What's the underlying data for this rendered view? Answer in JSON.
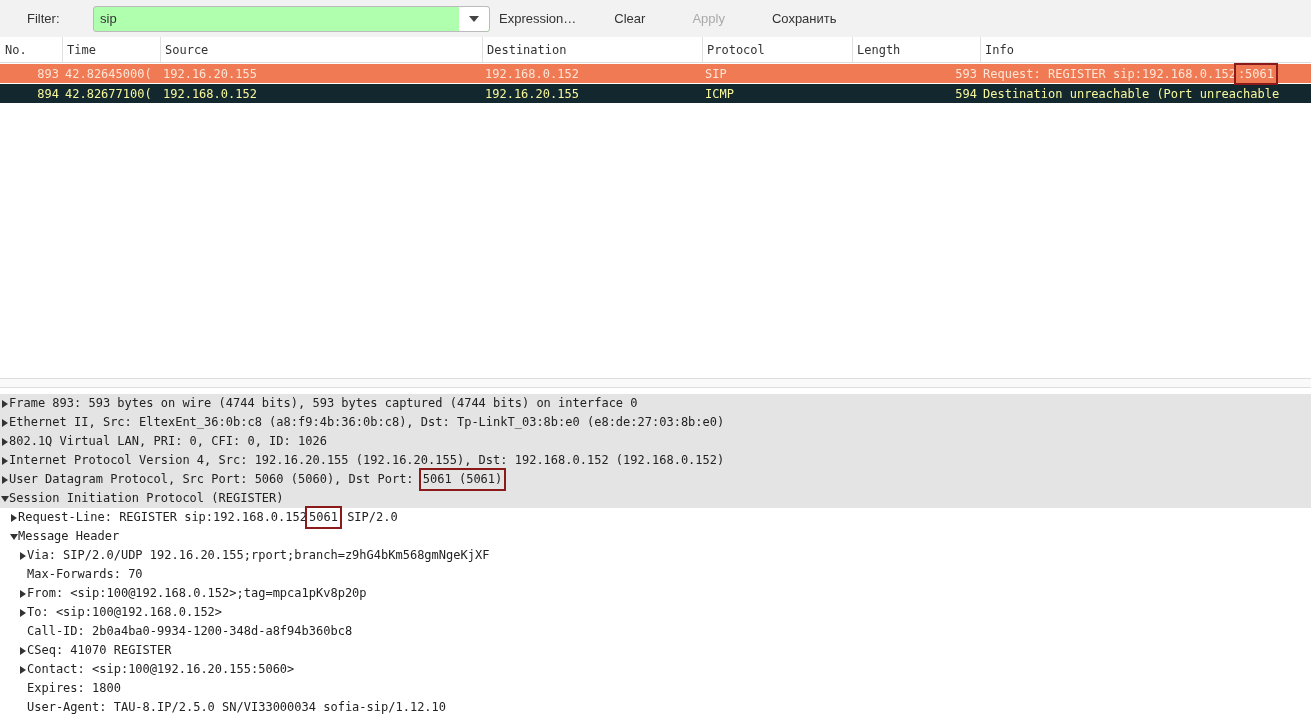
{
  "filter_bar": {
    "label": "Filter:",
    "field": {
      "value": "sip",
      "valid": true
    },
    "buttons": [
      {
        "label": "Expression…",
        "disabled": false
      },
      {
        "label": "Clear",
        "disabled": false
      },
      {
        "label": "Apply",
        "disabled": true
      },
      {
        "label": "Сохранить",
        "disabled": false
      }
    ]
  },
  "packet_list": {
    "columns": [
      "No.",
      "Time",
      "Source",
      "Destination",
      "Protocol",
      "Length",
      "Info"
    ],
    "rows": [
      {
        "cells": [
          "893",
          "42.82645000(",
          "192.16.20.155",
          "192.168.0.152",
          "SIP",
          "593"
        ],
        "info": [
          {
            "text": "Request: REGISTER sip:192.168.0.152"
          },
          {
            "text": ":5061",
            "highlight": true
          }
        ],
        "color": "#ef7a53",
        "selected": false
      },
      {
        "cells": [
          "894",
          "42.82677100(",
          "192.168.0.152",
          "192.16.20.155",
          "ICMP",
          "594"
        ],
        "info": [
          {
            "text": "Destination unreachable (Port unreachable"
          }
        ],
        "color": "#12272e",
        "selected": false
      }
    ]
  },
  "details": [
    {
      "kind": "node",
      "expanded": false,
      "parts": [
        {
          "text": "Frame 893: 593 bytes on wire (4744 bits), 593 bytes captured (4744 bits) on interface 0"
        }
      ]
    },
    {
      "kind": "node",
      "expanded": false,
      "parts": [
        {
          "text": "Ethernet II, Src: EltexEnt_36:0b:c8 (a8:f9:4b:36:0b:c8), Dst: Tp-LinkT_03:8b:e0 (e8:de:27:03:8b:e0)"
        }
      ]
    },
    {
      "kind": "node",
      "expanded": false,
      "parts": [
        {
          "text": "802.1Q Virtual LAN, PRI: 0, CFI: 0, ID: 1026"
        }
      ]
    },
    {
      "kind": "node",
      "expanded": false,
      "parts": [
        {
          "text": "Internet Protocol Version 4, Src: 192.16.20.155 (192.16.20.155), Dst: 192.168.0.152 (192.168.0.152)"
        }
      ]
    },
    {
      "kind": "node",
      "expanded": false,
      "parts": [
        {
          "text": "User Datagram Protocol, Src Port: 5060 (5060), Dst Port: "
        },
        {
          "text": "5061 (5061)",
          "highlight": true
        }
      ]
    },
    {
      "kind": "node",
      "expanded": true,
      "parts": [
        {
          "text": "Session Initiation Protocol (REGISTER)"
        }
      ],
      "children": [
        {
          "kind": "node",
          "expanded": false,
          "parts": [
            {
              "text": "Request-Line: REGISTER sip:192.168.0.152"
            },
            {
              "text": "5061",
              "highlight": true
            },
            {
              "text": "SIP/2.0"
            }
          ]
        },
        {
          "kind": "node",
          "expanded": true,
          "parts": [
            {
              "text": "Message Header"
            }
          ],
          "children": [
            {
              "kind": "node",
              "expanded": false,
              "parts": [
                {
                  "text": "Via: SIP/2.0/UDP 192.16.20.155;rport;branch=z9hG4bKm568gmNgeKjXF"
                }
              ]
            },
            {
              "kind": "leaf",
              "parts": [
                {
                  "text": "Max-Forwards: 70"
                }
              ]
            },
            {
              "kind": "node",
              "expanded": false,
              "parts": [
                {
                  "text": "From: <sip:100@192.168.0.152>;tag=mpca1pKv8p20p"
                }
              ]
            },
            {
              "kind": "node",
              "expanded": false,
              "parts": [
                {
                  "text": "To: <sip:100@192.168.0.152>"
                }
              ]
            },
            {
              "kind": "leaf",
              "parts": [
                {
                  "text": "Call-ID: 2b0a4ba0-9934-1200-348d-a8f94b360bc8"
                }
              ]
            },
            {
              "kind": "node",
              "expanded": false,
              "parts": [
                {
                  "text": "CSeq: 41070 REGISTER"
                }
              ]
            },
            {
              "kind": "node",
              "expanded": false,
              "parts": [
                {
                  "text": "Contact: <sip:100@192.16.20.155:5060>"
                }
              ]
            },
            {
              "kind": "leaf",
              "parts": [
                {
                  "text": "Expires: 1800"
                }
              ]
            },
            {
              "kind": "leaf",
              "parts": [
                {
                  "text": "User-Agent: TAU-8.IP/2.5.0 SN/VI33000034 sofia-sip/1.12.10"
                }
              ]
            }
          ]
        }
      ]
    }
  ]
}
